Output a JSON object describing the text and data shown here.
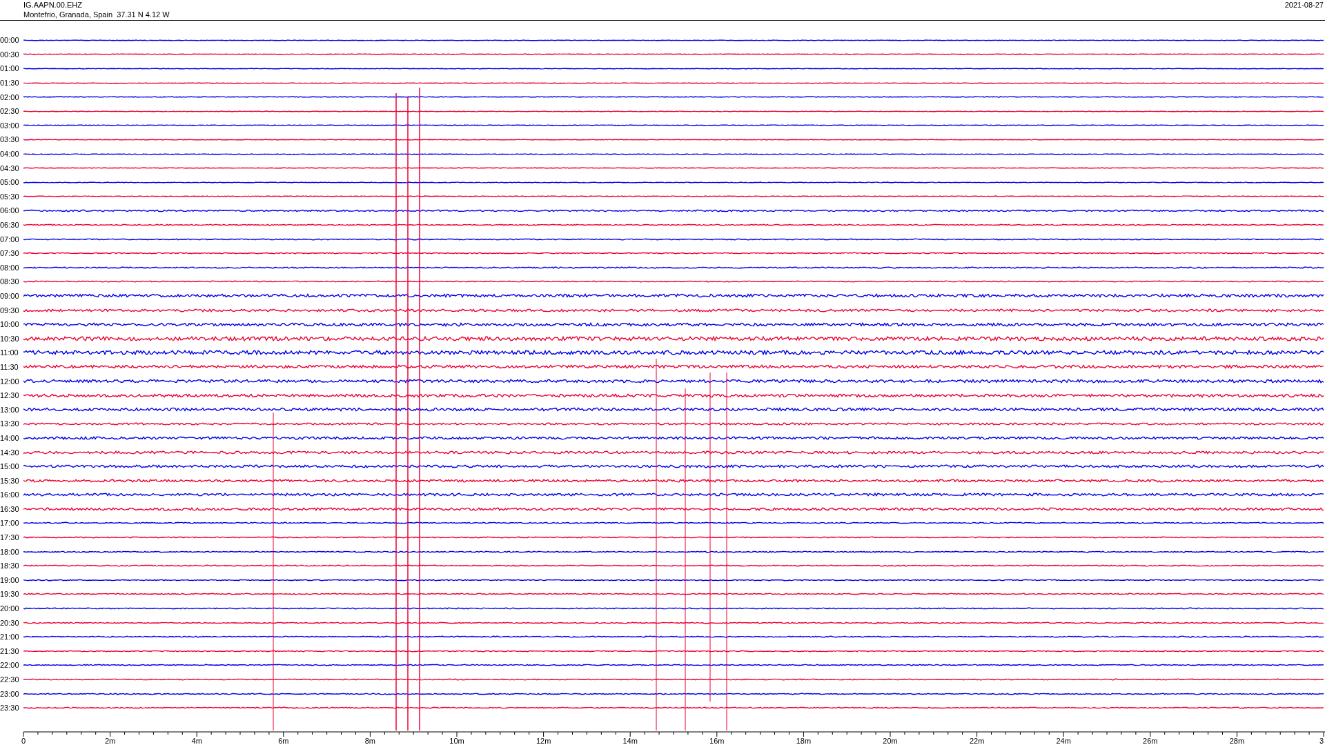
{
  "header": {
    "station": "IG.AAPN.00.EHZ",
    "location": "Montefrio, Granada, Spain  37.31 N 4.12 W",
    "date": "2021-08-27"
  },
  "traces": [
    {
      "time": "00:00",
      "color": "#0000ee"
    },
    {
      "time": "00:30",
      "color": "#ee0033"
    },
    {
      "time": "01:00",
      "color": "#0000ee"
    },
    {
      "time": "01:30",
      "color": "#ee0033"
    },
    {
      "time": "02:00",
      "color": "#0000ee"
    },
    {
      "time": "02:30",
      "color": "#ee0033"
    },
    {
      "time": "03:00",
      "color": "#0000ee"
    },
    {
      "time": "03:30",
      "color": "#ee0033"
    },
    {
      "time": "04:00",
      "color": "#0000ee"
    },
    {
      "time": "04:30",
      "color": "#ee0033"
    },
    {
      "time": "05:00",
      "color": "#0000ee"
    },
    {
      "time": "05:30",
      "color": "#ee0033"
    },
    {
      "time": "06:00",
      "color": "#0000ee"
    },
    {
      "time": "06:30",
      "color": "#ee0033"
    },
    {
      "time": "07:00",
      "color": "#0000ee"
    },
    {
      "time": "07:30",
      "color": "#ee0033"
    },
    {
      "time": "08:00",
      "color": "#0000ee"
    },
    {
      "time": "08:30",
      "color": "#ee0033"
    },
    {
      "time": "09:00",
      "color": "#0000ee"
    },
    {
      "time": "09:30",
      "color": "#ee0033"
    },
    {
      "time": "10:00",
      "color": "#0000ee"
    },
    {
      "time": "10:30",
      "color": "#ee0033"
    },
    {
      "time": "11:00",
      "color": "#0000ee"
    },
    {
      "time": "11:30",
      "color": "#ee0033"
    },
    {
      "time": "12:00",
      "color": "#0000ee"
    },
    {
      "time": "12:30",
      "color": "#ee0033"
    },
    {
      "time": "13:00",
      "color": "#0000ee"
    },
    {
      "time": "13:30",
      "color": "#ee0033"
    },
    {
      "time": "14:00",
      "color": "#0000ee"
    },
    {
      "time": "14:30",
      "color": "#ee0033"
    },
    {
      "time": "15:00",
      "color": "#0000ee"
    },
    {
      "time": "15:30",
      "color": "#ee0033"
    },
    {
      "time": "16:00",
      "color": "#0000ee"
    },
    {
      "time": "16:30",
      "color": "#ee0033"
    },
    {
      "time": "17:00",
      "color": "#0000ee"
    },
    {
      "time": "17:30",
      "color": "#ee0033"
    },
    {
      "time": "18:00",
      "color": "#0000ee"
    },
    {
      "time": "18:30",
      "color": "#ee0033"
    },
    {
      "time": "19:00",
      "color": "#0000ee"
    },
    {
      "time": "19:30",
      "color": "#ee0033"
    },
    {
      "time": "20:00",
      "color": "#0000ee"
    },
    {
      "time": "20:30",
      "color": "#ee0033"
    },
    {
      "time": "21:00",
      "color": "#0000ee"
    },
    {
      "time": "21:30",
      "color": "#ee0033"
    },
    {
      "time": "22:00",
      "color": "#0000ee"
    },
    {
      "time": "22:30",
      "color": "#ee0033"
    },
    {
      "time": "23:00",
      "color": "#0000ee"
    },
    {
      "time": "23:30",
      "color": "#ee0033"
    }
  ],
  "x_axis": {
    "ticks": [
      "0",
      "2m",
      "4m",
      "6m",
      "8m",
      "10m",
      "12m",
      "14m",
      "16m",
      "18m",
      "20m",
      "22m",
      "24m",
      "26m",
      "28m",
      "3"
    ]
  }
}
